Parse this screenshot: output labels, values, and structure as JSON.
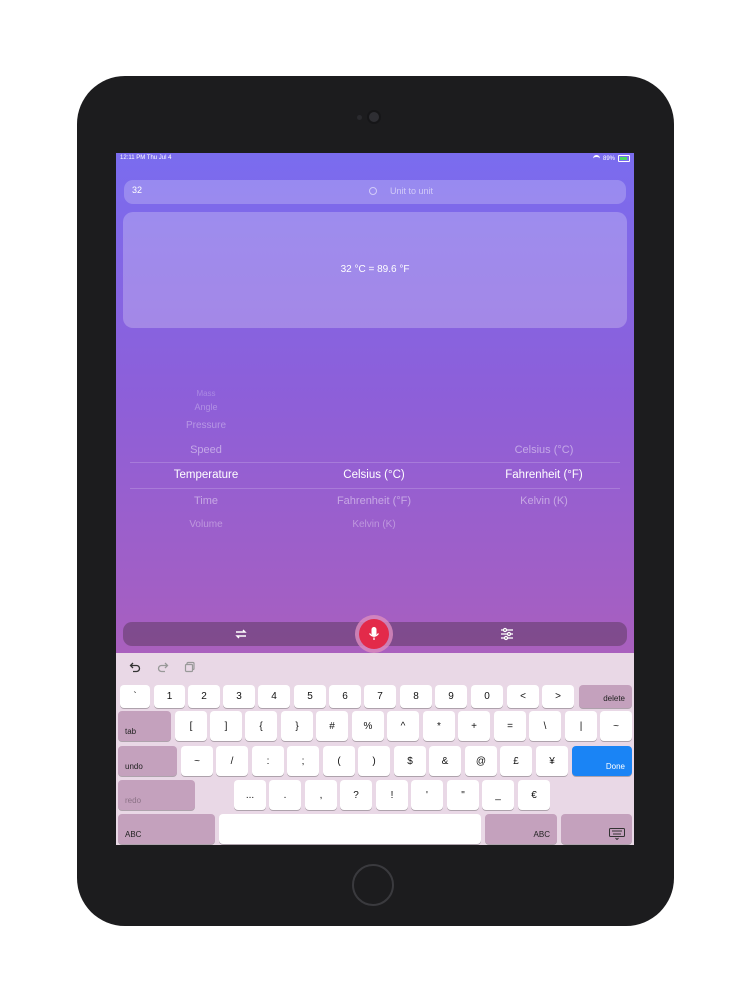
{
  "status_bar": {
    "time": "12:11 PM  Thu Jul 4",
    "battery": "89%"
  },
  "search": {
    "value": "32",
    "placeholder": "Unit to unit"
  },
  "result": {
    "text": "32 °C = 89.6 °F"
  },
  "picker": {
    "categories": [
      "Mass",
      "Angle",
      "Pressure",
      "Speed",
      "Temperature",
      "Time",
      "Volume"
    ],
    "selected_category": "Temperature",
    "from_units": [
      "Celsius (°C)",
      "Fahrenheit (°F)",
      "Kelvin (K)"
    ],
    "selected_from": "Celsius (°C)",
    "to_units": [
      "Celsius (°C)",
      "Fahrenheit (°F)",
      "Kelvin (K)"
    ],
    "selected_to": "Fahrenheit (°F)"
  },
  "toolbar": {
    "swap_icon": "swap-arrows-icon",
    "mic_icon": "microphone-icon",
    "settings_icon": "sliders-icon",
    "mic_color": "#e32a4a"
  },
  "keyboard": {
    "row1": [
      "`",
      "1",
      "2",
      "3",
      "4",
      "5",
      "6",
      "7",
      "8",
      "9",
      "0",
      "<",
      ">"
    ],
    "delete": "delete",
    "tab": "tab",
    "row2": [
      "[",
      "]",
      "{",
      "}",
      "#",
      "%",
      "^",
      "*",
      "+",
      "=",
      "\\",
      "|",
      "~"
    ],
    "undo": "undo",
    "row3": [
      "~",
      "/",
      ":",
      ";",
      "(",
      ")",
      "$",
      "&",
      "@",
      "£",
      "¥"
    ],
    "done": "Done",
    "redo": "redo",
    "row4": [
      "...",
      ".",
      ",",
      "?",
      "!",
      "'",
      "\"",
      "_",
      "€"
    ],
    "abc_left": "ABC",
    "abc_right": "ABC",
    "done_color": "#1a84f5"
  }
}
